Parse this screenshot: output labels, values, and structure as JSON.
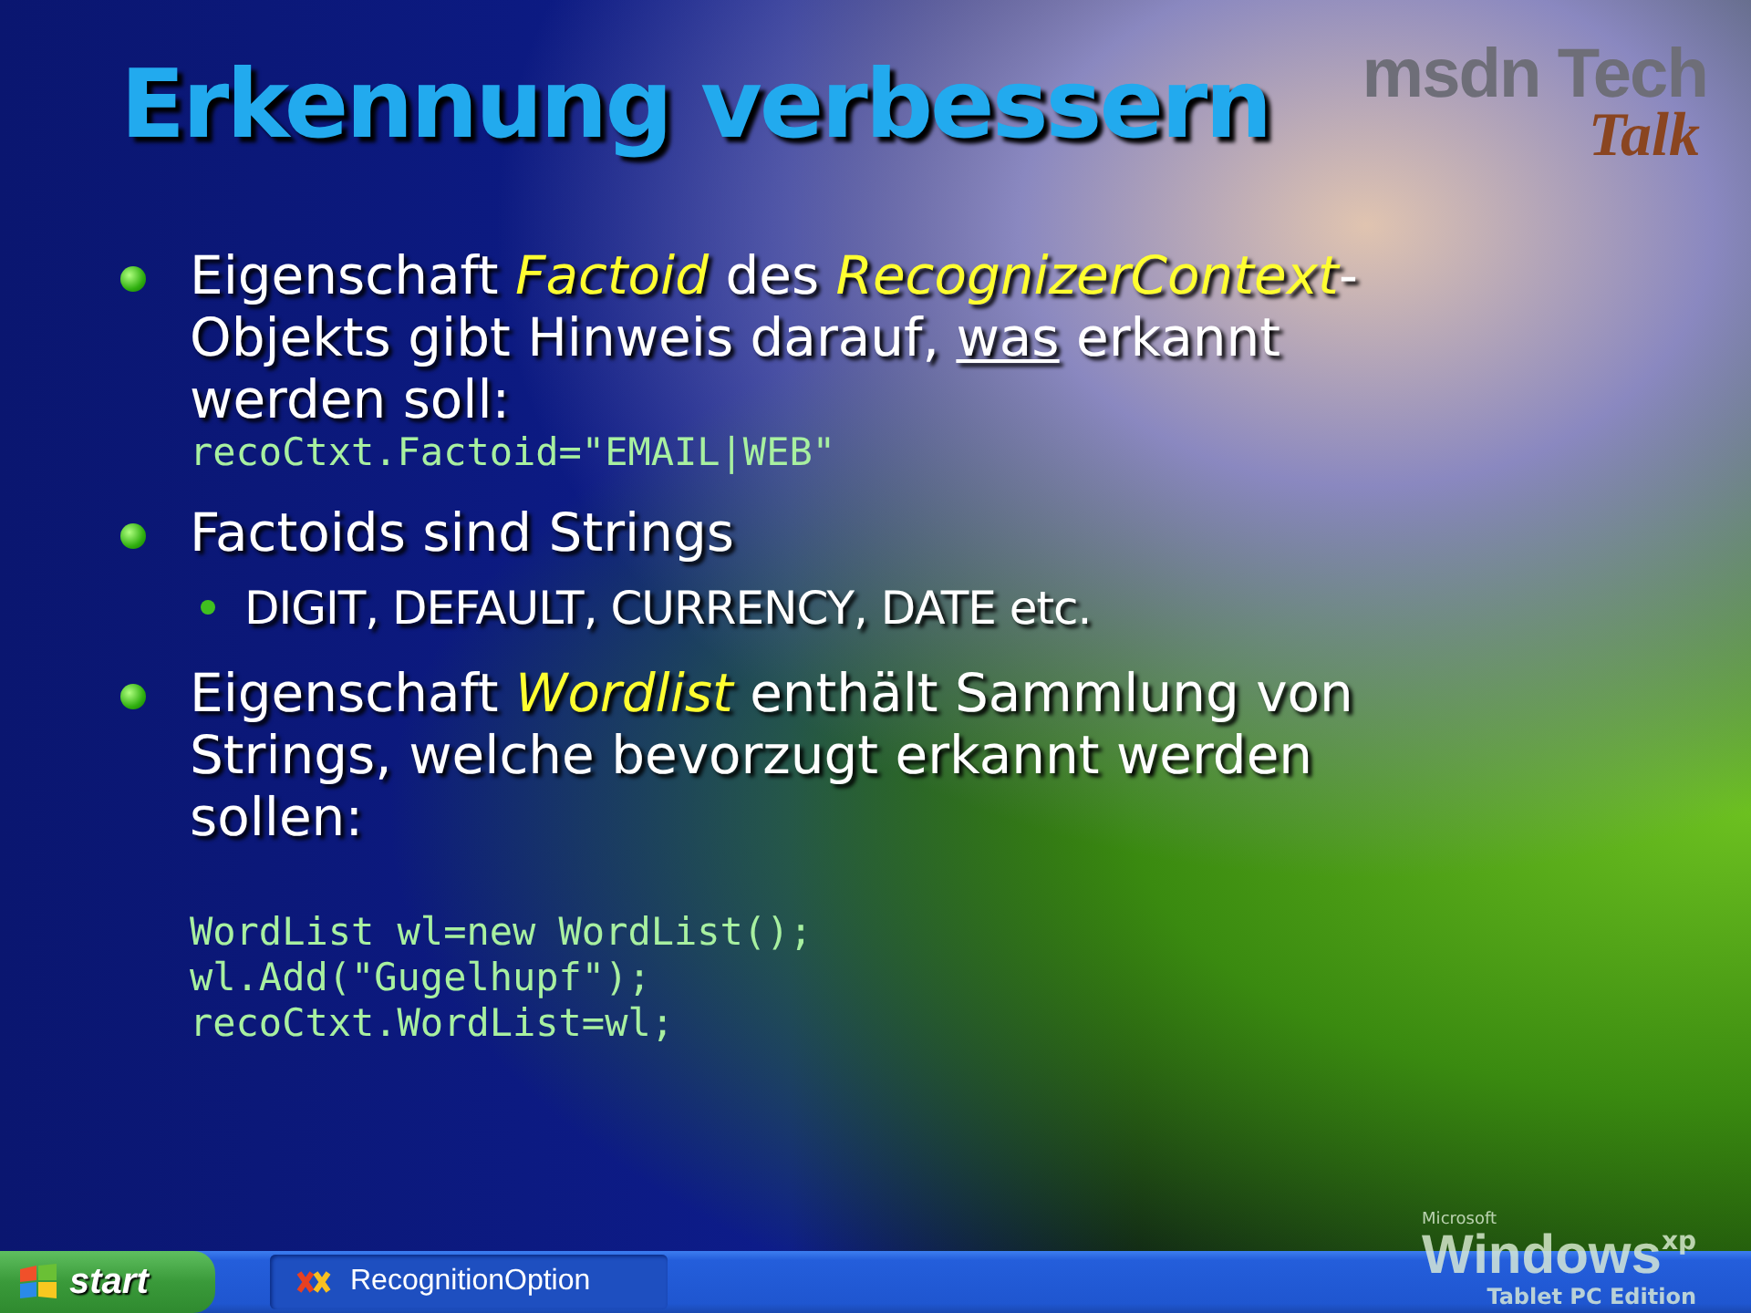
{
  "slide": {
    "title": "Erkennung verbessern",
    "logo": {
      "brand": "msdn Tech",
      "script": "Talk"
    },
    "bullets": [
      {
        "segments": [
          {
            "kind": "plain",
            "text": "Eigenschaft "
          },
          {
            "kind": "emphasis",
            "text": "Factoid"
          },
          {
            "kind": "plain",
            "text": " des "
          },
          {
            "kind": "emphasis",
            "text": "RecognizerContext"
          },
          {
            "kind": "plain",
            "text": "-Objekts gibt Hinweis darauf, "
          },
          {
            "kind": "underline",
            "text": "was"
          },
          {
            "kind": "plain",
            "text": " erkannt werden soll:"
          }
        ],
        "code": [
          "recoCtxt.Factoid=\"EMAIL|WEB\""
        ]
      },
      {
        "segments": [
          {
            "kind": "plain",
            "text": "Factoids sind Strings"
          }
        ],
        "children": [
          {
            "text": "DIGIT, DEFAULT, CURRENCY, DATE etc."
          }
        ]
      },
      {
        "segments": [
          {
            "kind": "plain",
            "text": "Eigenschaft "
          },
          {
            "kind": "emphasis",
            "text": "Wordlist"
          },
          {
            "kind": "plain",
            "text": " enthält Sammlung von Strings, welche bevorzugt erkannt werden sollen:"
          }
        ],
        "code": [
          "WordList wl=new WordList();",
          "wl.Add(\"Gugelhupf\");",
          "recoCtxt.WordList=wl;"
        ],
        "gap": true
      }
    ]
  },
  "desktop_logo": {
    "maker": "Microsoft",
    "product": "Windows",
    "version": "xp",
    "edition": "Tablet PC Edition"
  },
  "taskbar": {
    "start": "start",
    "tasks": [
      {
        "label": "RecognitionOption",
        "selected": true
      }
    ]
  }
}
